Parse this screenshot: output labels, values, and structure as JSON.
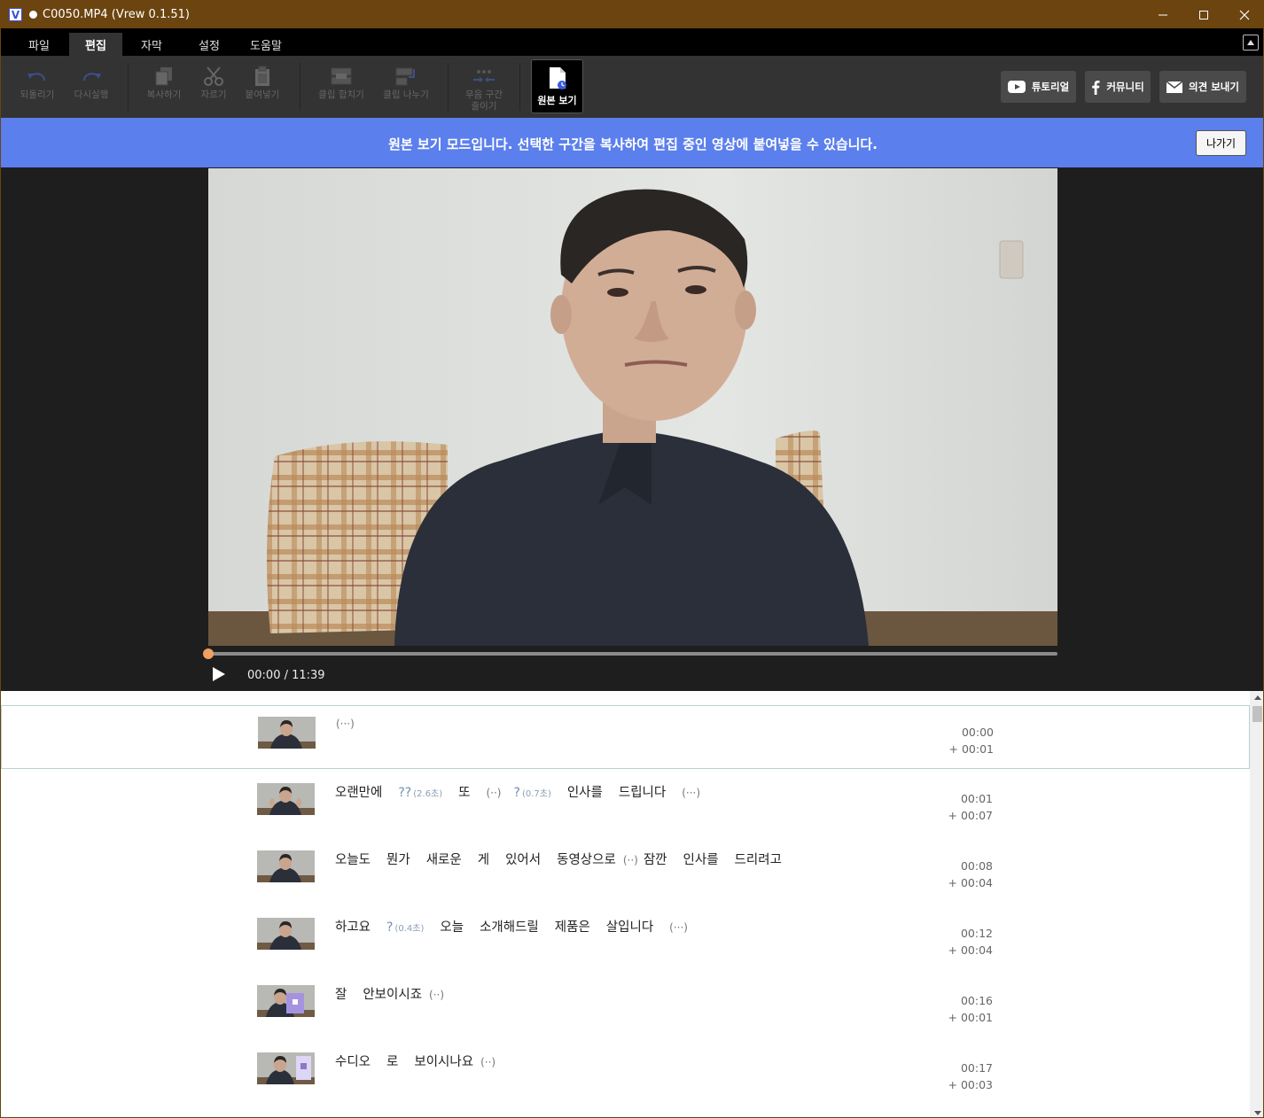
{
  "window": {
    "title": "C0050.MP4 (Vrew 0.1.51)",
    "logo_letter": "V"
  },
  "menu": {
    "tabs": [
      "파일",
      "편집",
      "자막",
      "설정",
      "도움말"
    ]
  },
  "toolbar": {
    "undo": "되돌리기",
    "redo": "다시실행",
    "copy": "복사하기",
    "cut": "자르기",
    "paste": "붙여넣기",
    "merge_clip": "클립 합치기",
    "split_clip": "클립 나누기",
    "shrink_silence_1": "무음 구간",
    "shrink_silence_2": "줄이기",
    "view_original": "원본 보기",
    "tutorial": "튜토리얼",
    "community": "커뮤니티",
    "feedback": "의견 보내기"
  },
  "banner": {
    "message": "원본 보기 모드입니다. 선택한 구간을 복사하여 편집 중인 영상에 붙여넣을 수 있습니다.",
    "exit_label": "나가기"
  },
  "player": {
    "time": "00:00 / 11:39",
    "progress": 0
  },
  "transcript": [
    {
      "words": [
        "(···)"
      ],
      "start": "00:00",
      "duration": "+ 00:01"
    },
    {
      "words": [
        "오랜만에",
        "??(2.6초)",
        "또",
        "(··)",
        "?(0.7초)",
        "인사를",
        "드립니다",
        "(···)"
      ],
      "start": "00:01",
      "duration": "+ 00:07"
    },
    {
      "words": [
        "오늘도",
        "뭔가",
        "새로운",
        "게",
        "있어서",
        "동영상으로",
        "(··)",
        "잠깐",
        "인사를",
        "드리려고"
      ],
      "start": "00:08",
      "duration": "+ 00:04"
    },
    {
      "words": [
        "하고요",
        "?(0.4초)",
        "오늘",
        "소개해드릴",
        "제품은",
        "살입니다",
        "(···)"
      ],
      "start": "00:12",
      "duration": "+ 00:04"
    },
    {
      "words": [
        "잘",
        "안보이시죠",
        "(··)"
      ],
      "start": "00:16",
      "duration": "+ 00:01"
    },
    {
      "words": [
        "수디오",
        "로",
        "보이시나요",
        "(··)"
      ],
      "start": "00:17",
      "duration": "+ 00:03"
    }
  ],
  "colors": {
    "titlebar": "#6b4410",
    "banner": "#5b7fed",
    "accent_knob": "#f0a060"
  }
}
